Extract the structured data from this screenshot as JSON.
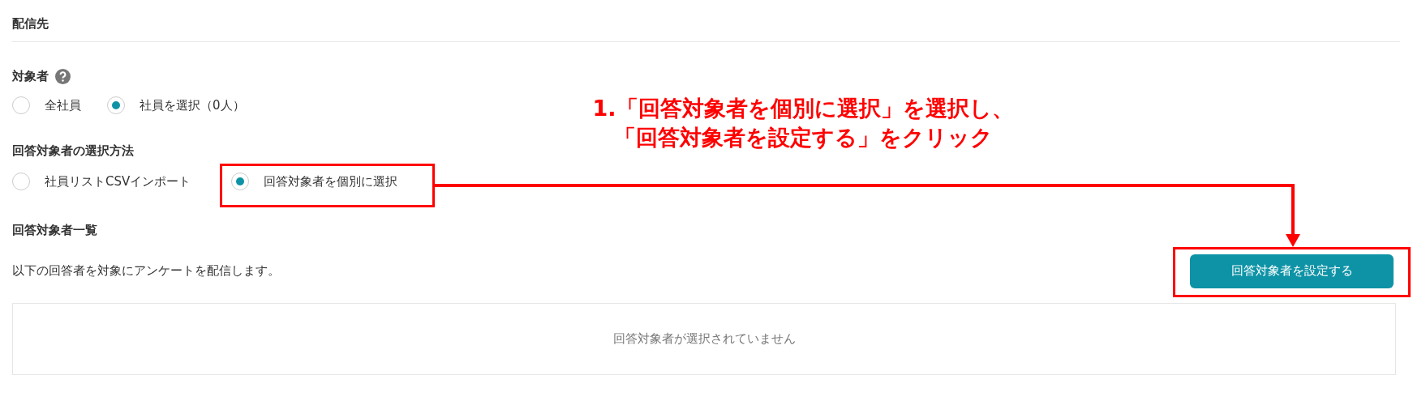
{
  "section_title": "配信先",
  "target": {
    "label": "対象者",
    "options": [
      {
        "label": "全社員",
        "selected": false
      },
      {
        "label": "社員を選択（0人）",
        "selected": true
      }
    ]
  },
  "method": {
    "label": "回答対象者の選択方法",
    "options": [
      {
        "label": "社員リストCSVインポート",
        "selected": false
      },
      {
        "label": "回答対象者を個別に選択",
        "selected": true
      }
    ]
  },
  "list": {
    "label": "回答対象者一覧",
    "description": "以下の回答者を対象にアンケートを配信します。",
    "button": "回答対象者を設定する",
    "empty_message": "回答対象者が選択されていません"
  },
  "annotation": {
    "lines": [
      "1.「回答対象者を個別に選択」を選択し、",
      "「回答対象者を設定する」をクリック"
    ]
  }
}
